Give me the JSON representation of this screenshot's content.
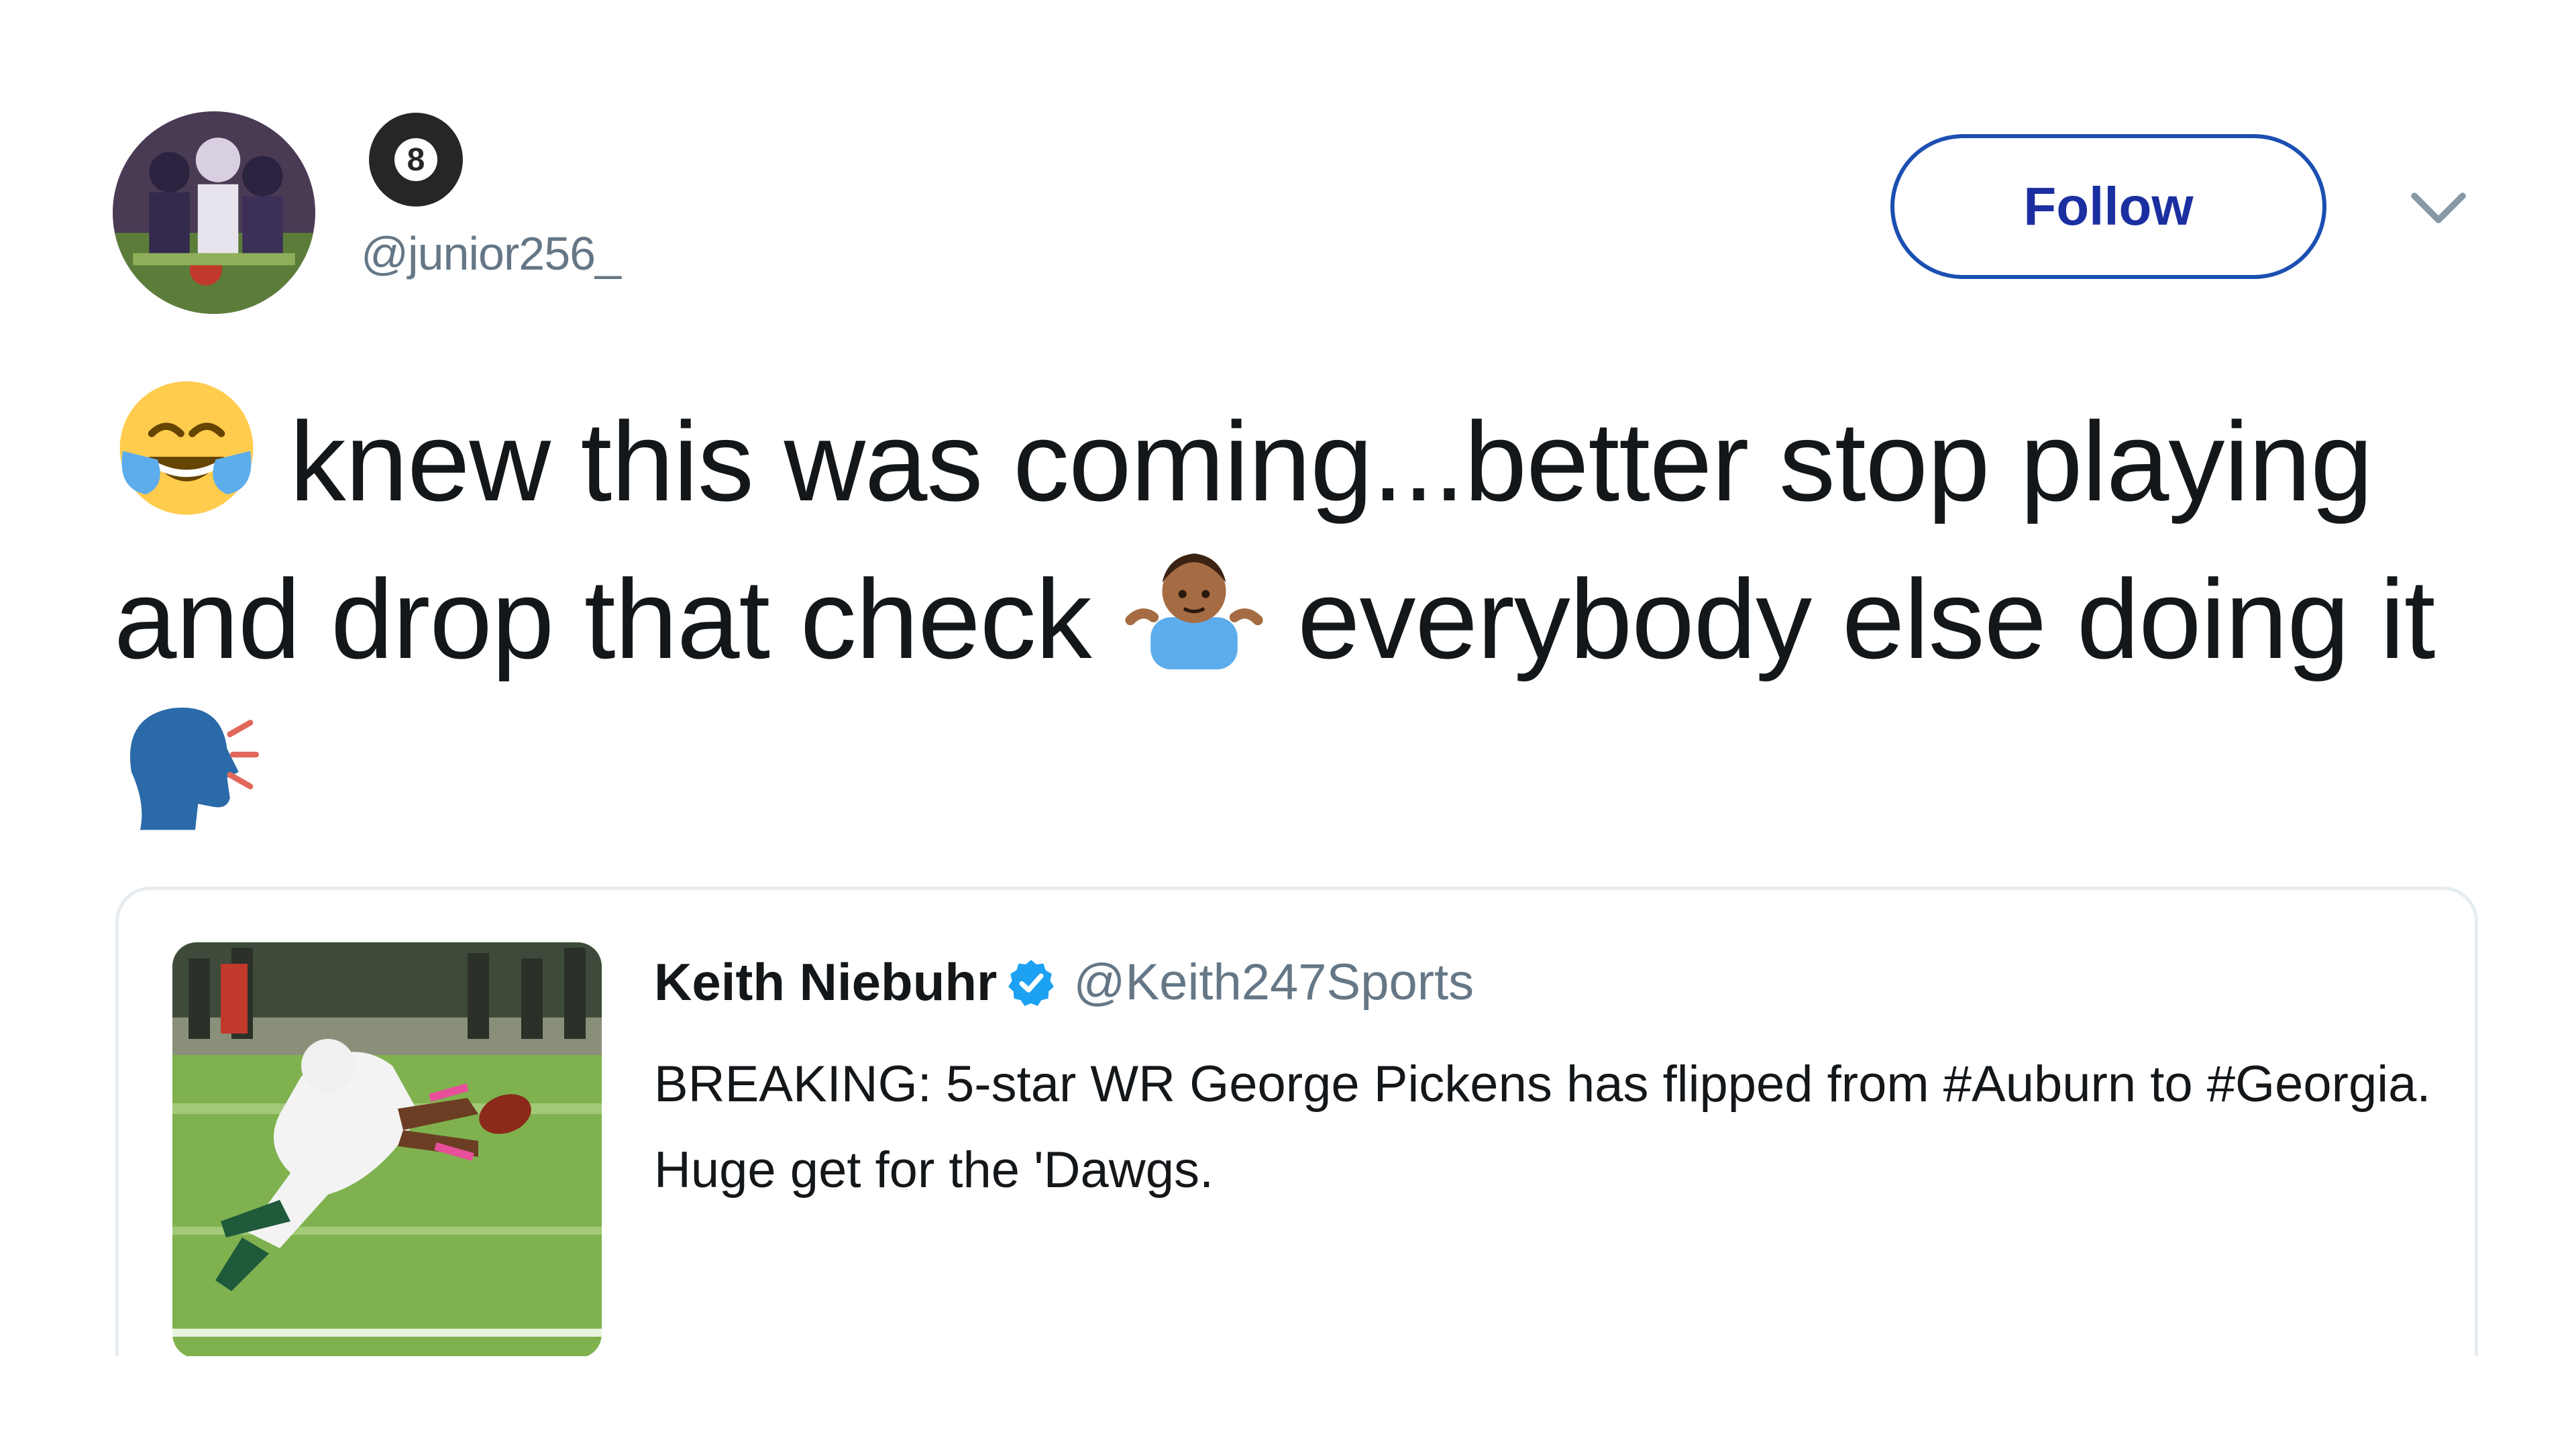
{
  "author": {
    "handle": "@junior256_",
    "badge_symbol": "8",
    "avatar_icon": "avatar-icon"
  },
  "actions": {
    "follow_label": "Follow",
    "menu_icon": "chevron-down-icon"
  },
  "tweet": {
    "text_part1": "knew this was coming...better stop playing and drop that check",
    "text_part2": "everybody else doing it",
    "emojis": [
      "face-with-tears-of-joy-emoji",
      "man-shrugging-emoji",
      "speaking-head-emoji"
    ]
  },
  "quoted_tweet": {
    "name": "Keith Niebuhr",
    "verified_icon": "verified-badge-icon",
    "handle": "@Keith247Sports",
    "text": "BREAKING: 5-star WR George Pickens has flipped from #Auburn to #Georgia. Huge get for the 'Dawgs.",
    "image_icon": "football-photo"
  },
  "colors": {
    "follow_border": "#1b4fb2",
    "follow_text": "#1b2fa0",
    "handle_gray": "#657786",
    "text_dark": "#14171a",
    "verified_blue": "#1da1f2",
    "card_border": "#e6ecf0"
  }
}
